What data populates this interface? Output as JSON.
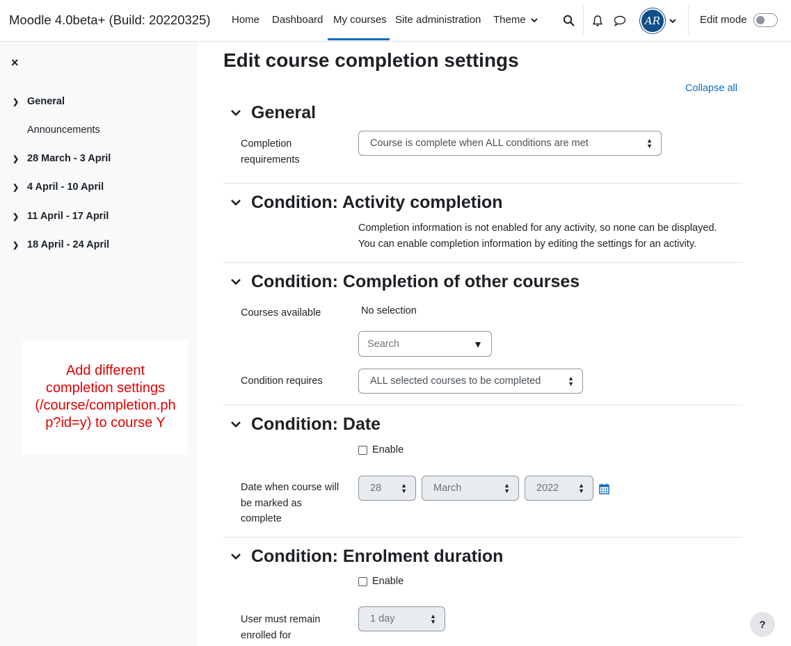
{
  "navbar": {
    "brand": "Moodle 4.0beta+ (Build: 20220325)",
    "items": [
      "Home",
      "Dashboard",
      "My courses",
      "Site administration",
      "Theme"
    ],
    "active_item": "My courses",
    "avatar_initials": "AR",
    "edit_mode_label": "Edit mode",
    "edit_mode_on": false,
    "icons": [
      "search-icon",
      "bell-icon",
      "chat-icon",
      "chevron-down-icon"
    ]
  },
  "drawer": {
    "close_icon": "×",
    "sections": [
      {
        "label": "General",
        "children": [
          "Announcements"
        ]
      },
      {
        "label": "28 March - 3 April"
      },
      {
        "label": "4 April - 10 April"
      },
      {
        "label": "11 April - 17 April"
      },
      {
        "label": "18 April - 24 April"
      }
    ]
  },
  "annotation": {
    "line1": "Add different",
    "line2": "completion settings",
    "line3": "(/course/completion.ph",
    "line4": "p?id=y) to course Y"
  },
  "page": {
    "title": "Edit course completion settings",
    "collapse_all": "Collapse all"
  },
  "sections": {
    "general": {
      "title": "General",
      "completion_req_label_1": "Completion",
      "completion_req_label_2": "requirements",
      "completion_req_value": "Course is complete when ALL conditions are met"
    },
    "activity": {
      "title": "Condition: Activity completion",
      "info_line1": "Completion information is not enabled for any activity, so none can be displayed.",
      "info_line2": "You can enable completion information by editing the settings for an activity."
    },
    "other_courses": {
      "title": "Condition: Completion of other courses",
      "courses_label": "Courses available",
      "no_selection": "No selection",
      "search_placeholder": "Search",
      "requires_label": "Condition requires",
      "requires_value": "ALL selected courses to be completed"
    },
    "date": {
      "title": "Condition: Date",
      "enable_label": "Enable",
      "enabled": false,
      "date_label_1": "Date when course will",
      "date_label_2": "be marked as",
      "date_label_3": "complete",
      "day": "28",
      "month": "March",
      "year": "2022"
    },
    "enrolment": {
      "title": "Condition: Enrolment duration",
      "enable_label": "Enable",
      "enabled": false,
      "duration_label_1": "User must remain",
      "duration_label_2": "enrolled for",
      "duration_value": "1 day"
    }
  },
  "help_button": "?",
  "colors": {
    "accent": "#0f6cbf",
    "annotation": "#e00000"
  }
}
